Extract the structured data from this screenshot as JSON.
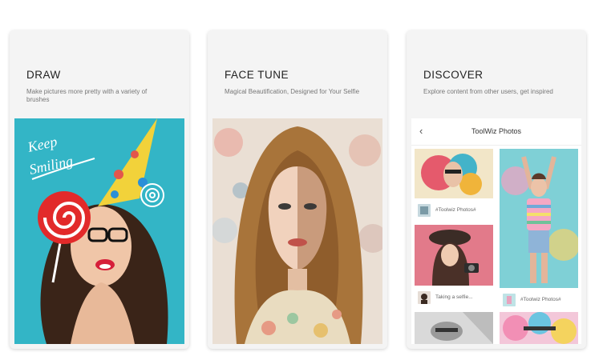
{
  "cards": [
    {
      "title": "DRAW",
      "subtitle": "Make pictures more pretty with a variety of brushes",
      "sticker": "Keep Smiling"
    },
    {
      "title": "FACE TUNE",
      "subtitle": "Magical Beautification, Designed for Your Selfie"
    },
    {
      "title": "DISCOVER",
      "subtitle": "Explore content from other users, get inspired"
    }
  ],
  "discover_app": {
    "back_icon": "‹",
    "title": "ToolWiz Photos",
    "feed": [
      {
        "tag": "#Toolwiz Photos#"
      },
      {
        "tag": "Taking a selfie..."
      },
      {
        "tag": "#Toolwiz Photos#"
      }
    ]
  },
  "colors": {
    "draw_bg": "#33b5c6",
    "hat": "#f2d23a",
    "lollipop": "#e22a2a",
    "card_bg": "#f4f4f4"
  }
}
